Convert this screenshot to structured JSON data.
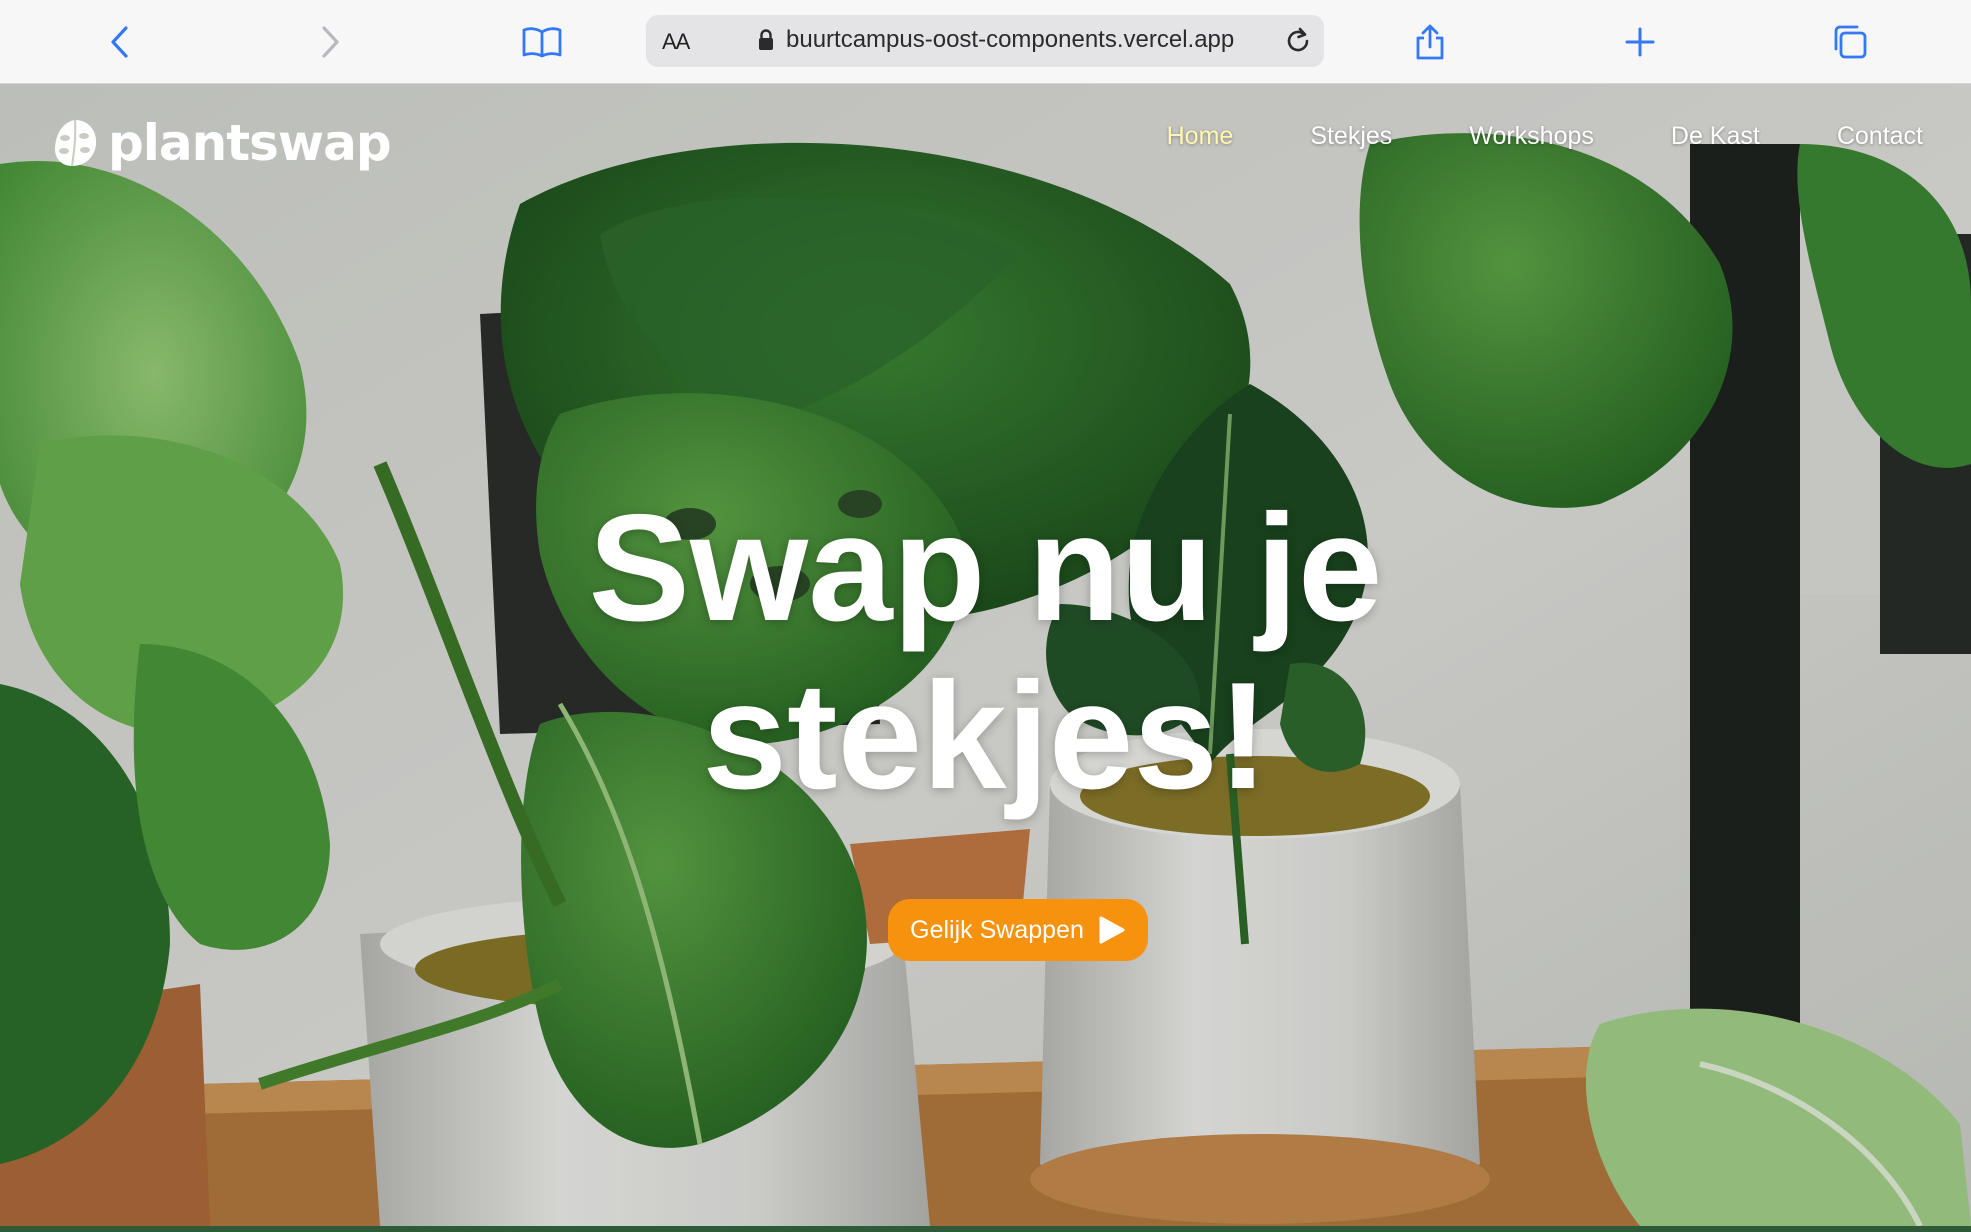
{
  "browser": {
    "text_size_label": "AA",
    "url": "buurtcampus-oost-components.vercel.app",
    "icons": [
      "back-icon",
      "forward-icon",
      "bookmarks-icon",
      "lock-icon",
      "reload-icon",
      "share-icon",
      "new-tab-icon",
      "tabs-icon"
    ]
  },
  "site": {
    "logo_text": "plantswap",
    "nav": [
      {
        "label": "Home",
        "active": true
      },
      {
        "label": "Stekjes",
        "active": false
      },
      {
        "label": "Workshops",
        "active": false
      },
      {
        "label": "De Kast",
        "active": false
      },
      {
        "label": "Contact",
        "active": false
      }
    ]
  },
  "hero": {
    "title_line1": "Swap nu je",
    "title_line2": "stekjes!",
    "cta_label": "Gelijk Swappen"
  },
  "colors": {
    "cta": "#f7920f",
    "nav_active": "#fff6b0",
    "browser_accent": "#3478f6"
  }
}
